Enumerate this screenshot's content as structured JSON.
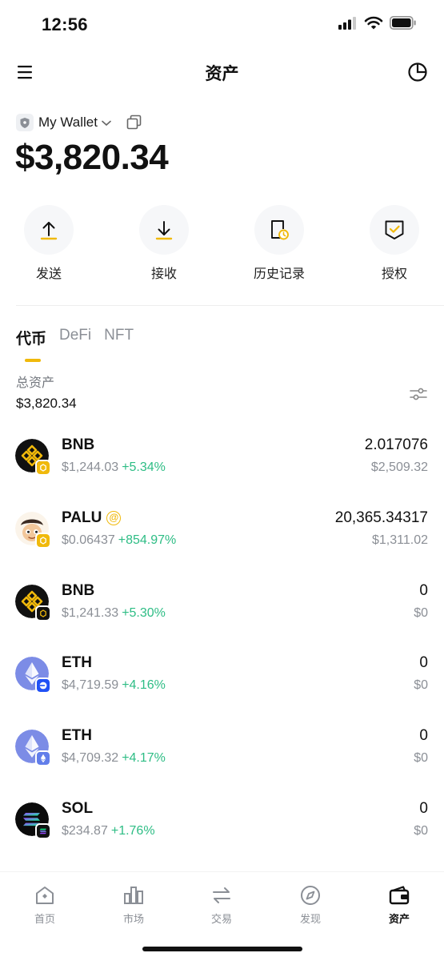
{
  "status_bar": {
    "time": "12:56"
  },
  "nav": {
    "title": "资产",
    "icons": [
      "menu-icon",
      "pie-chart-icon"
    ]
  },
  "wallet": {
    "name": "My Wallet",
    "balance": "$3,820.34"
  },
  "actions": [
    {
      "label": "发送",
      "icon": "upload-arrow-icon"
    },
    {
      "label": "接收",
      "icon": "download-arrow-icon"
    },
    {
      "label": "历史记录",
      "icon": "history-clock-icon"
    },
    {
      "label": "授权",
      "icon": "authorize-check-icon"
    }
  ],
  "tabs": [
    {
      "label": "代币",
      "active": true
    },
    {
      "label": "DeFi",
      "active": false
    },
    {
      "label": "NFT",
      "active": false
    }
  ],
  "total": {
    "label": "总资产",
    "value": "$3,820.34"
  },
  "tokens": [
    {
      "symbol": "BNB",
      "price": "$1,244.03",
      "change": "+5.34%",
      "amount": "2.017076",
      "fiat": "$2,509.32",
      "logo": "bnb-logo",
      "badge": "bnb-chain"
    },
    {
      "symbol": "PALU",
      "price": "$0.06437",
      "change": "+854.97%",
      "amount": "20,365.34317",
      "fiat": "$1,311.02",
      "logo": "palu-logo",
      "badge": "bnb-chain",
      "tag": "@"
    },
    {
      "symbol": "BNB",
      "price": "$1,241.33",
      "change": "+5.30%",
      "amount": "0",
      "fiat": "$0",
      "logo": "bnb-logo",
      "badge": "opbnb-chain"
    },
    {
      "symbol": "ETH",
      "price": "$4,719.59",
      "change": "+4.16%",
      "amount": "0",
      "fiat": "$0",
      "logo": "eth-logo",
      "badge": "base-chain"
    },
    {
      "symbol": "ETH",
      "price": "$4,709.32",
      "change": "+4.17%",
      "amount": "0",
      "fiat": "$0",
      "logo": "eth-logo",
      "badge": "ethereum-chain"
    },
    {
      "symbol": "SOL",
      "price": "$234.87",
      "change": "+1.76%",
      "amount": "0",
      "fiat": "$0",
      "logo": "sol-logo",
      "badge": "solana-chain"
    }
  ],
  "tab_bar": [
    {
      "label": "首页",
      "icon": "home-icon",
      "active": false
    },
    {
      "label": "市场",
      "icon": "market-bars-icon",
      "active": false
    },
    {
      "label": "交易",
      "icon": "swap-arrows-icon",
      "active": false
    },
    {
      "label": "发现",
      "icon": "compass-icon",
      "active": false
    },
    {
      "label": "资产",
      "icon": "wallet-icon",
      "active": true
    }
  ],
  "colors": {
    "accent": "#f0b90b",
    "positive": "#2ebd85",
    "muted": "#8b8f96",
    "text": "#111111"
  }
}
